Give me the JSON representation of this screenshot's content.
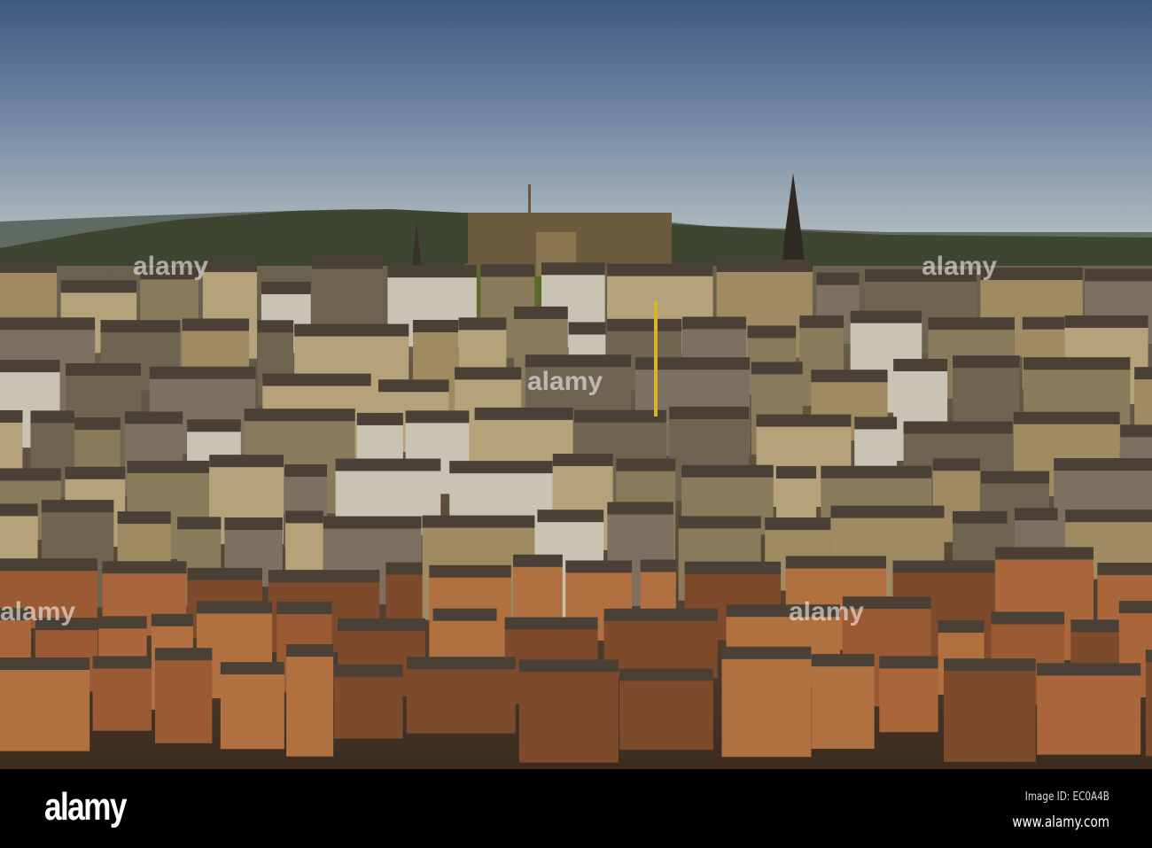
{
  "photo": {
    "subject": "Edinburgh city skyline with castle",
    "watermark_text": "alamy",
    "colors": {
      "sky_top": "#4a6285",
      "sky_bottom": "#aeb9c0",
      "hill": "#3d4a2c",
      "stone": "#8a7452",
      "brick": "#8a5232",
      "roof": "#4b4238"
    }
  },
  "footer": {
    "logo": "alamy",
    "image_id": "Image ID: EC0A4B",
    "website": "www.alamy.com"
  }
}
